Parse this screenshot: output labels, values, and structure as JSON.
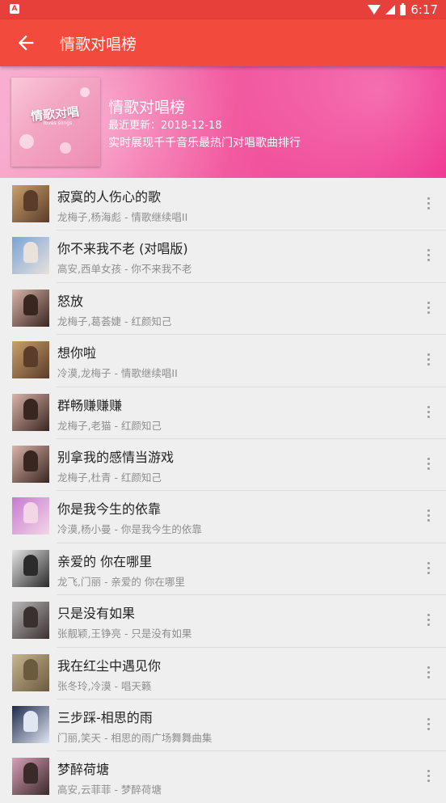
{
  "status_bar": {
    "time": "6:17",
    "app_badge": "A"
  },
  "toolbar": {
    "title": "情歌对唱榜"
  },
  "header": {
    "title": "情歌对唱榜",
    "updated": "最近更新：2018-12-18",
    "description": "实时展现千千音乐最热门对唱歌曲排行",
    "cover_text": "情歌对唱",
    "cover_subtext": "loves songs"
  },
  "songs": [
    {
      "title": "寂寞的人伤心的歌",
      "subtitle": "龙梅子,杨海彪 - 情歌继续唱II",
      "c1": "#c9a16b",
      "c2": "#5b3b2a"
    },
    {
      "title": "你不来我不老 (对唱版)",
      "subtitle": "高安,西单女孩 - 你不来我不老",
      "c1": "#7aa3d6",
      "c2": "#e8e1dc"
    },
    {
      "title": "怒放",
      "subtitle": "龙梅子,葛荟婕 - 红颜知己",
      "c1": "#d9b3a8",
      "c2": "#3a2621"
    },
    {
      "title": "想你啦",
      "subtitle": "冷漠,龙梅子 - 情歌继续唱II",
      "c1": "#c9a16b",
      "c2": "#5b3b2a"
    },
    {
      "title": "群畅赚赚赚",
      "subtitle": "龙梅子,老猫 - 红颜知己",
      "c1": "#d9b3a8",
      "c2": "#3a2621"
    },
    {
      "title": "别拿我的感情当游戏",
      "subtitle": "龙梅子,杜青 - 红颜知己",
      "c1": "#d9b3a8",
      "c2": "#3a2621"
    },
    {
      "title": "你是我今生的依靠",
      "subtitle": "冷漠,杨小曼 - 你是我今生的依靠",
      "c1": "#c77ad1",
      "c2": "#f2d6e6"
    },
    {
      "title": "亲爱的 你在哪里",
      "subtitle": "龙飞,门丽 - 亲爱的 你在哪里",
      "c1": "#e4e4e4",
      "c2": "#2b2b2b"
    },
    {
      "title": "只是没有如果",
      "subtitle": "张靓颖,王铮亮 - 只是没有如果",
      "c1": "#b9b9b9",
      "c2": "#3b3030"
    },
    {
      "title": "我在红尘中遇见你",
      "subtitle": "张冬玲,冷漠 - 唱天籁",
      "c1": "#c8b690",
      "c2": "#6a5a3e"
    },
    {
      "title": "三步踩-相思的雨",
      "subtitle": "门丽,笑天 - 相思的雨广场舞舞曲集",
      "c1": "#1e2b4a",
      "c2": "#e0e6f2"
    },
    {
      "title": "梦醉荷塘",
      "subtitle": "高安,云菲菲 - 梦醉荷塘",
      "c1": "#d8a0b8",
      "c2": "#3a2a2a"
    }
  ]
}
